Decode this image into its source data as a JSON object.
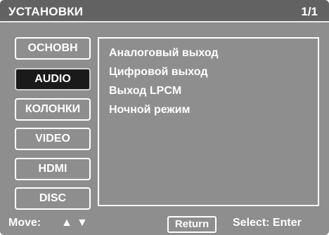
{
  "header": {
    "title": "УСТАНОВКИ",
    "page": "1/1"
  },
  "sidebar": {
    "items": [
      {
        "label": "ОСНОВН",
        "active": false
      },
      {
        "label": "AUDIO",
        "active": true
      },
      {
        "label": "КОЛОНКИ",
        "active": false
      },
      {
        "label": "VIDEO",
        "active": false
      },
      {
        "label": "HDMI",
        "active": false
      },
      {
        "label": "DISC",
        "active": false
      }
    ]
  },
  "content": {
    "items": [
      {
        "label": "Аналоговый выход"
      },
      {
        "label": "Цифровой выход"
      },
      {
        "label": "Выход LPCM"
      },
      {
        "label": "Ночной режим"
      }
    ]
  },
  "footer": {
    "move_label": "Move:",
    "up_arrow": "▲",
    "down_arrow": "▼",
    "return_label": "Return",
    "select_label": "Select: Enter"
  },
  "colors": {
    "background": "#8e8e8e",
    "header": "#626262",
    "active_item": "#1a1a1a",
    "text": "#ffffff"
  }
}
